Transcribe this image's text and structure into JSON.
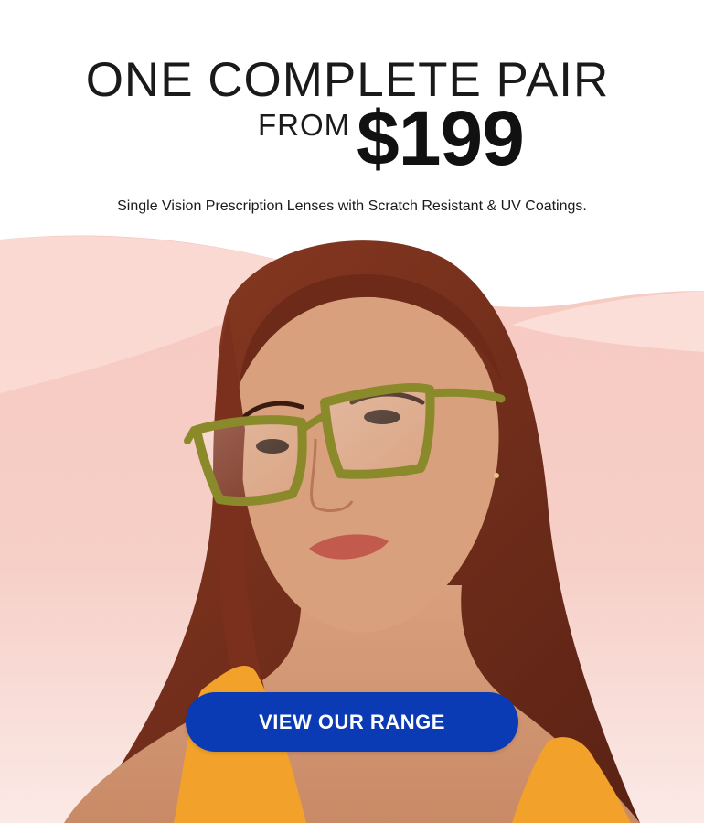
{
  "promo": {
    "headline": "ONE COMPLETE PAIR",
    "from_label": "FROM",
    "price": "$199",
    "subline": "Single Vision Prescription Lenses with Scratch Resistant & UV Coatings.",
    "cta_label": "VIEW OUR RANGE"
  },
  "colors": {
    "cta_background": "#0a3bb5",
    "background_pink": "#f6c8c0",
    "frame_color": "#8a8a2a",
    "top_color": "#f2a22a"
  }
}
